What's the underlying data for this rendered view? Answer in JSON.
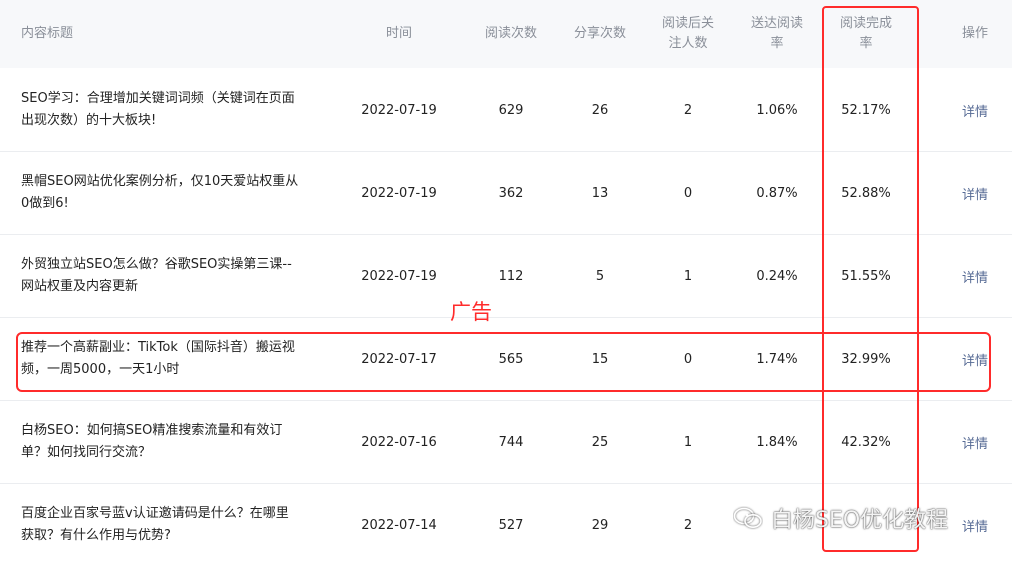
{
  "header": {
    "title": "内容标题",
    "time": "时间",
    "reads": "阅读次数",
    "shares": "分享次数",
    "follows_line1": "阅读后关",
    "follows_line2": "注人数",
    "delivery_line1": "送达阅读",
    "delivery_line2": "率",
    "complete_line1": "阅读完成",
    "complete_line2": "率",
    "action": "操作"
  },
  "rows": [
    {
      "title_line1": "SEO学习：合理增加关键词词频（关键词在页面",
      "title_line2": "出现次数）的十大板块!",
      "time": "2022-07-19",
      "reads": "629",
      "shares": "26",
      "follows": "2",
      "delivery": "1.06%",
      "complete": "52.17%",
      "action": "详情"
    },
    {
      "title_line1": "黑帽SEO网站优化案例分析，仅10天爱站权重从",
      "title_line2": "0做到6!",
      "time": "2022-07-19",
      "reads": "362",
      "shares": "13",
      "follows": "0",
      "delivery": "0.87%",
      "complete": "52.88%",
      "action": "详情"
    },
    {
      "title_line1": "外贸独立站SEO怎么做？谷歌SEO实操第三课--",
      "title_line2": "网站权重及内容更新",
      "time": "2022-07-19",
      "reads": "112",
      "shares": "5",
      "follows": "1",
      "delivery": "0.24%",
      "complete": "51.55%",
      "action": "详情"
    },
    {
      "title_line1": "推荐一个高薪副业：TikTok（国际抖音）搬运视",
      "title_line2": "频，一周5000，一天1小时",
      "time": "2022-07-17",
      "reads": "565",
      "shares": "15",
      "follows": "0",
      "delivery": "1.74%",
      "complete": "32.99%",
      "action": "详情"
    },
    {
      "title_line1": "白杨SEO：如何搞SEO精准搜索流量和有效订",
      "title_line2": "单？如何找同行交流？",
      "time": "2022-07-16",
      "reads": "744",
      "shares": "25",
      "follows": "1",
      "delivery": "1.84%",
      "complete": "42.32%",
      "action": "详情"
    },
    {
      "title_line1": "百度企业百家号蓝v认证邀请码是什么？在哪里",
      "title_line2": "获取？有什么作用与优势?",
      "time": "2022-07-14",
      "reads": "527",
      "shares": "29",
      "follows": "2",
      "delivery": "",
      "complete": "",
      "action": "详情"
    }
  ],
  "annotations": {
    "ad_label": "广告",
    "highlight_color": "#ff2b2b"
  },
  "watermark": {
    "text": "白杨SEO优化教程",
    "icon": "wechat-icon"
  },
  "colors": {
    "header_bg": "#f7f8fa",
    "header_text": "#8a8f99",
    "link": "#576b95",
    "divider": "#ebedf0"
  }
}
